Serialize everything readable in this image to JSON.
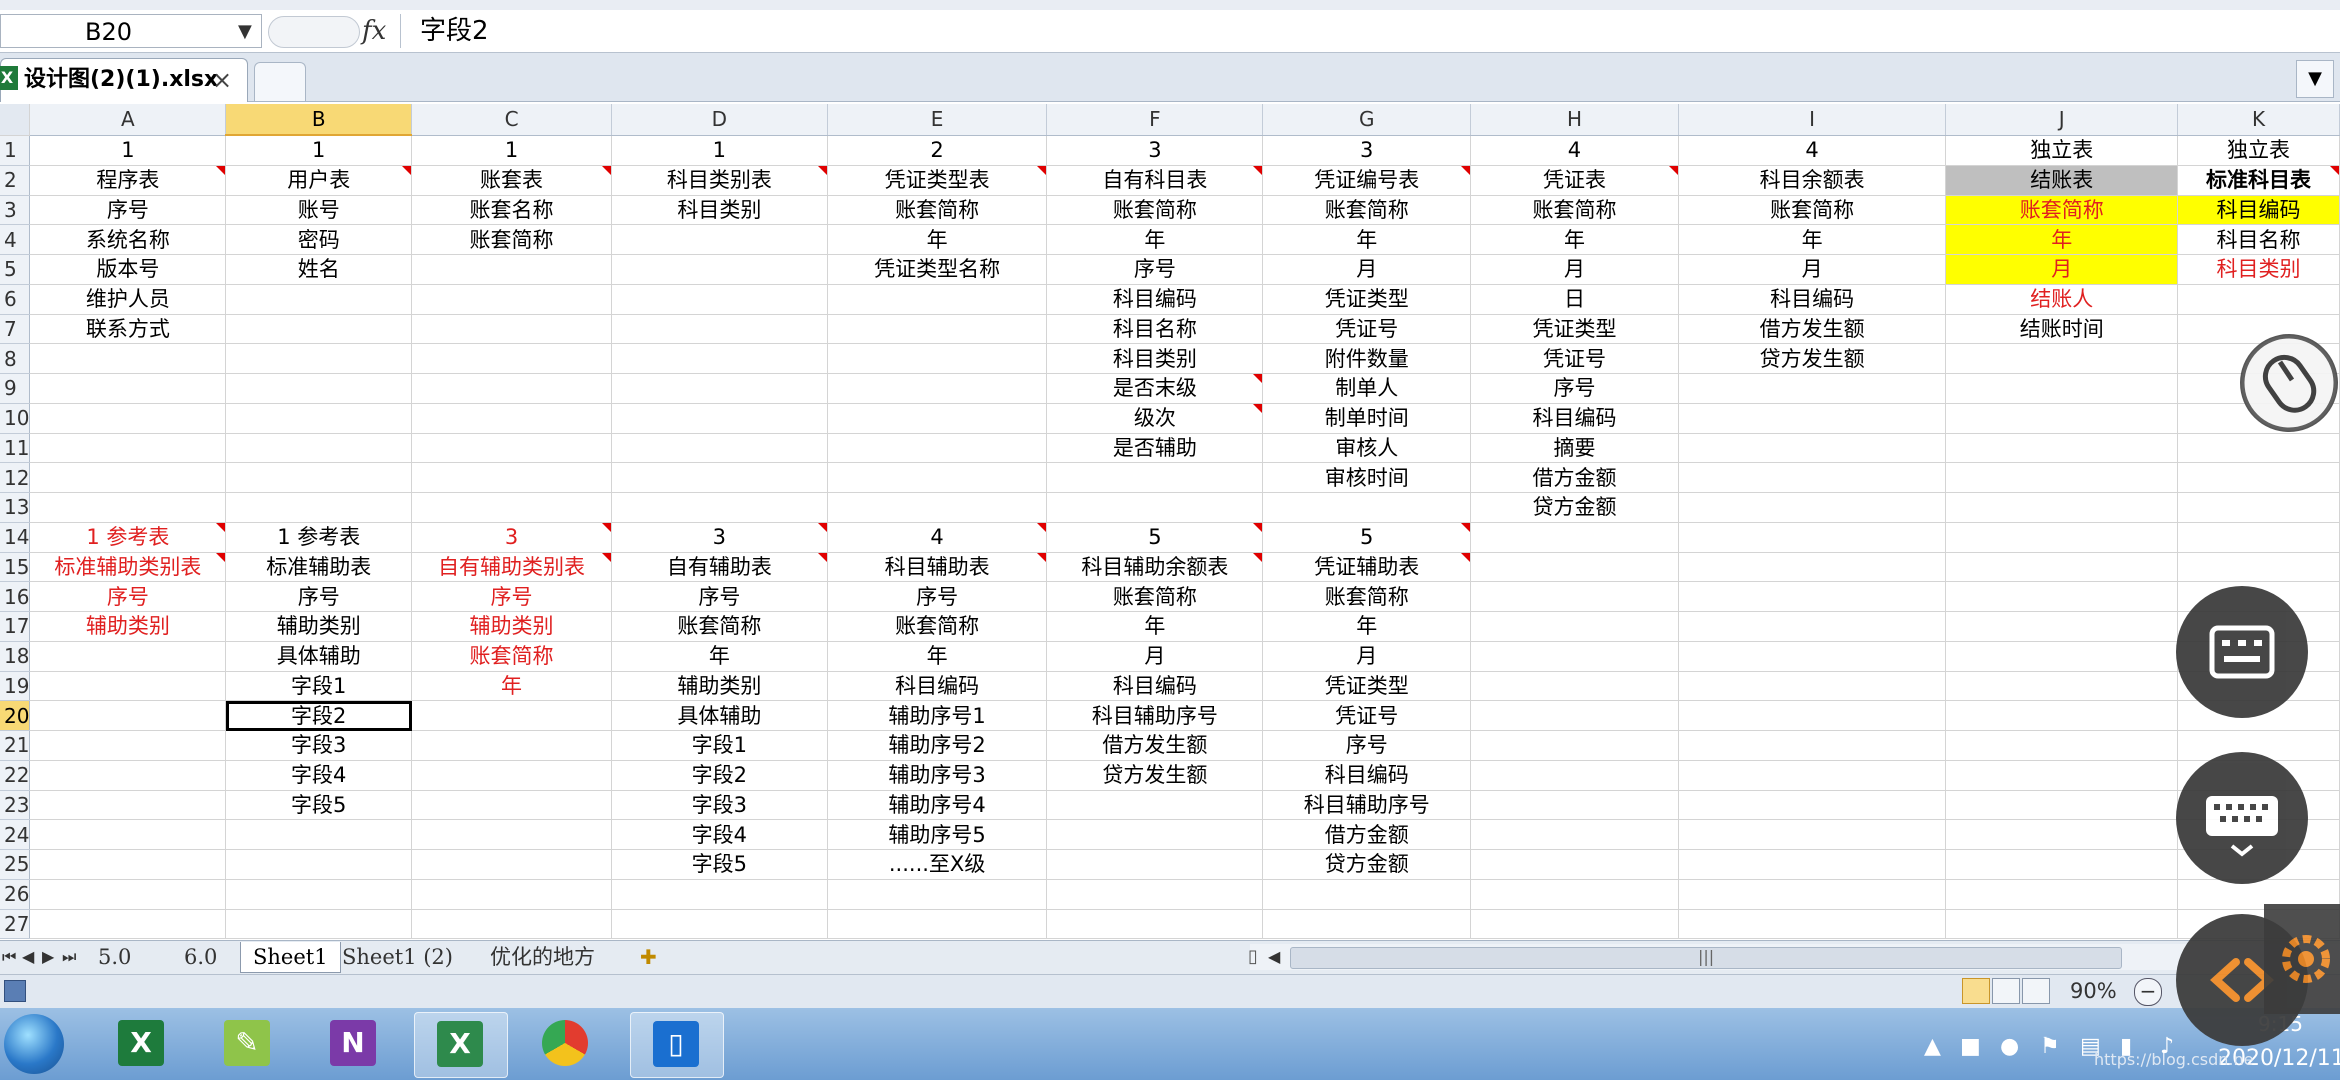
{
  "formula_bar": {
    "name_box": "B20",
    "fx_label": "fx",
    "content": "字段2"
  },
  "workbook_tab": {
    "filename": "设计图(2)(1).xlsx",
    "close": "×"
  },
  "columns": [
    "A",
    "B",
    "C",
    "D",
    "E",
    "F",
    "G",
    "H",
    "I",
    "J",
    "K"
  ],
  "selected_column": "B",
  "selected_row": 20,
  "rows": [
    {
      "n": "1",
      "cells": [
        "1",
        "1",
        "1",
        "1",
        "2",
        "3",
        "3",
        "4",
        "4",
        "独立表",
        "独立表"
      ]
    },
    {
      "n": "2",
      "cells": [
        "程序表",
        "用户表",
        "账套表",
        "科目类别表",
        "凭证类型表",
        "自有科目表",
        "凭证编号表",
        "凭证表",
        "科目余额表",
        "结账表",
        "标准科目表"
      ]
    },
    {
      "n": "3",
      "cells": [
        "序号",
        "账号",
        "账套名称",
        "科目类别",
        "账套简称",
        "账套简称",
        "账套简称",
        "账套简称",
        "账套简称",
        "账套简称",
        "科目编码"
      ]
    },
    {
      "n": "4",
      "cells": [
        "系统名称",
        "密码",
        "账套简称",
        "",
        "年",
        "年",
        "年",
        "年",
        "年",
        "年",
        "科目名称"
      ]
    },
    {
      "n": "5",
      "cells": [
        "版本号",
        "姓名",
        "",
        "",
        "凭证类型名称",
        "序号",
        "月",
        "月",
        "月",
        "月",
        "科目类别"
      ]
    },
    {
      "n": "6",
      "cells": [
        "维护人员",
        "",
        "",
        "",
        "",
        "科目编码",
        "凭证类型",
        "日",
        "科目编码",
        "结账人",
        ""
      ]
    },
    {
      "n": "7",
      "cells": [
        "联系方式",
        "",
        "",
        "",
        "",
        "科目名称",
        "凭证号",
        "凭证类型",
        "借方发生额",
        "结账时间",
        ""
      ]
    },
    {
      "n": "8",
      "cells": [
        "",
        "",
        "",
        "",
        "",
        "科目类别",
        "附件数量",
        "凭证号",
        "贷方发生额",
        "",
        ""
      ]
    },
    {
      "n": "9",
      "cells": [
        "",
        "",
        "",
        "",
        "",
        "是否末级",
        "制单人",
        "序号",
        "",
        "",
        ""
      ]
    },
    {
      "n": "10",
      "cells": [
        "",
        "",
        "",
        "",
        "",
        "级次",
        "制单时间",
        "科目编码",
        "",
        "",
        ""
      ]
    },
    {
      "n": "11",
      "cells": [
        "",
        "",
        "",
        "",
        "",
        "是否辅助",
        "审核人",
        "摘要",
        "",
        "",
        ""
      ]
    },
    {
      "n": "12",
      "cells": [
        "",
        "",
        "",
        "",
        "",
        "",
        "审核时间",
        "借方金额",
        "",
        "",
        ""
      ]
    },
    {
      "n": "13",
      "cells": [
        "",
        "",
        "",
        "",
        "",
        "",
        "",
        "贷方金额",
        "",
        "",
        ""
      ]
    },
    {
      "n": "14",
      "cells": [
        "1 参考表",
        "1 参考表",
        "3",
        "3",
        "4",
        "5",
        "5",
        "",
        "",
        "",
        ""
      ]
    },
    {
      "n": "15",
      "cells": [
        "标准辅助类别表",
        "标准辅助表",
        "自有辅助类别表",
        "自有辅助表",
        "科目辅助表",
        "科目辅助余额表",
        "凭证辅助表",
        "",
        "",
        "",
        ""
      ]
    },
    {
      "n": "16",
      "cells": [
        "序号",
        "序号",
        "序号",
        "序号",
        "序号",
        "账套简称",
        "账套简称",
        "",
        "",
        "",
        ""
      ]
    },
    {
      "n": "17",
      "cells": [
        "辅助类别",
        "辅助类别",
        "辅助类别",
        "账套简称",
        "账套简称",
        "年",
        "年",
        "",
        "",
        "",
        ""
      ]
    },
    {
      "n": "18",
      "cells": [
        "",
        "具体辅助",
        "账套简称",
        "年",
        "年",
        "月",
        "月",
        "",
        "",
        "",
        ""
      ]
    },
    {
      "n": "19",
      "cells": [
        "",
        "字段1",
        "年",
        "辅助类别",
        "科目编码",
        "科目编码",
        "凭证类型",
        "",
        "",
        "",
        ""
      ]
    },
    {
      "n": "20",
      "cells": [
        "",
        "字段2",
        "",
        "具体辅助",
        "辅助序号1",
        "科目辅助序号",
        "凭证号",
        "",
        "",
        "",
        ""
      ]
    },
    {
      "n": "21",
      "cells": [
        "",
        "字段3",
        "",
        "字段1",
        "辅助序号2",
        "借方发生额",
        "序号",
        "",
        "",
        "",
        ""
      ]
    },
    {
      "n": "22",
      "cells": [
        "",
        "字段4",
        "",
        "字段2",
        "辅助序号3",
        "贷方发生额",
        "科目编码",
        "",
        "",
        "",
        ""
      ]
    },
    {
      "n": "23",
      "cells": [
        "",
        "字段5",
        "",
        "字段3",
        "辅助序号4",
        "",
        "科目辅助序号",
        "",
        "",
        "",
        ""
      ]
    },
    {
      "n": "24",
      "cells": [
        "",
        "",
        "",
        "字段4",
        "辅助序号5",
        "",
        "借方金额",
        "",
        "",
        "",
        ""
      ]
    },
    {
      "n": "25",
      "cells": [
        "",
        "",
        "",
        "字段5",
        "......至X级",
        "",
        "贷方金额",
        "",
        "",
        "",
        ""
      ]
    },
    {
      "n": "26",
      "cells": [
        "",
        "",
        "",
        "",
        "",
        "",
        "",
        "",
        "",
        "",
        ""
      ]
    },
    {
      "n": "27",
      "cells": [
        "",
        "",
        "",
        "",
        "",
        "",
        "",
        "",
        "",
        "",
        ""
      ]
    }
  ],
  "sheet_tabs": [
    "5.0",
    "6.0",
    "Sheet1",
    "Sheet1 (2)",
    "优化的地方"
  ],
  "active_sheet": "Sheet1",
  "status": {
    "zoom": "90%",
    "zoom_out": "−"
  },
  "taskbar": {
    "apps": [
      "excel-2010",
      "notepad-plus",
      "onenote",
      "excel-active",
      "chrome",
      "phone-app"
    ],
    "clock_time": "9:15",
    "clock_date": "2020/12/11",
    "watermark": "https://blog.csdn.ne"
  },
  "colors": {
    "red_text": "#e02020",
    "yellow_fill": "#ffff00",
    "gray_fill": "#bfbfbf",
    "selection": "#f8d975"
  }
}
